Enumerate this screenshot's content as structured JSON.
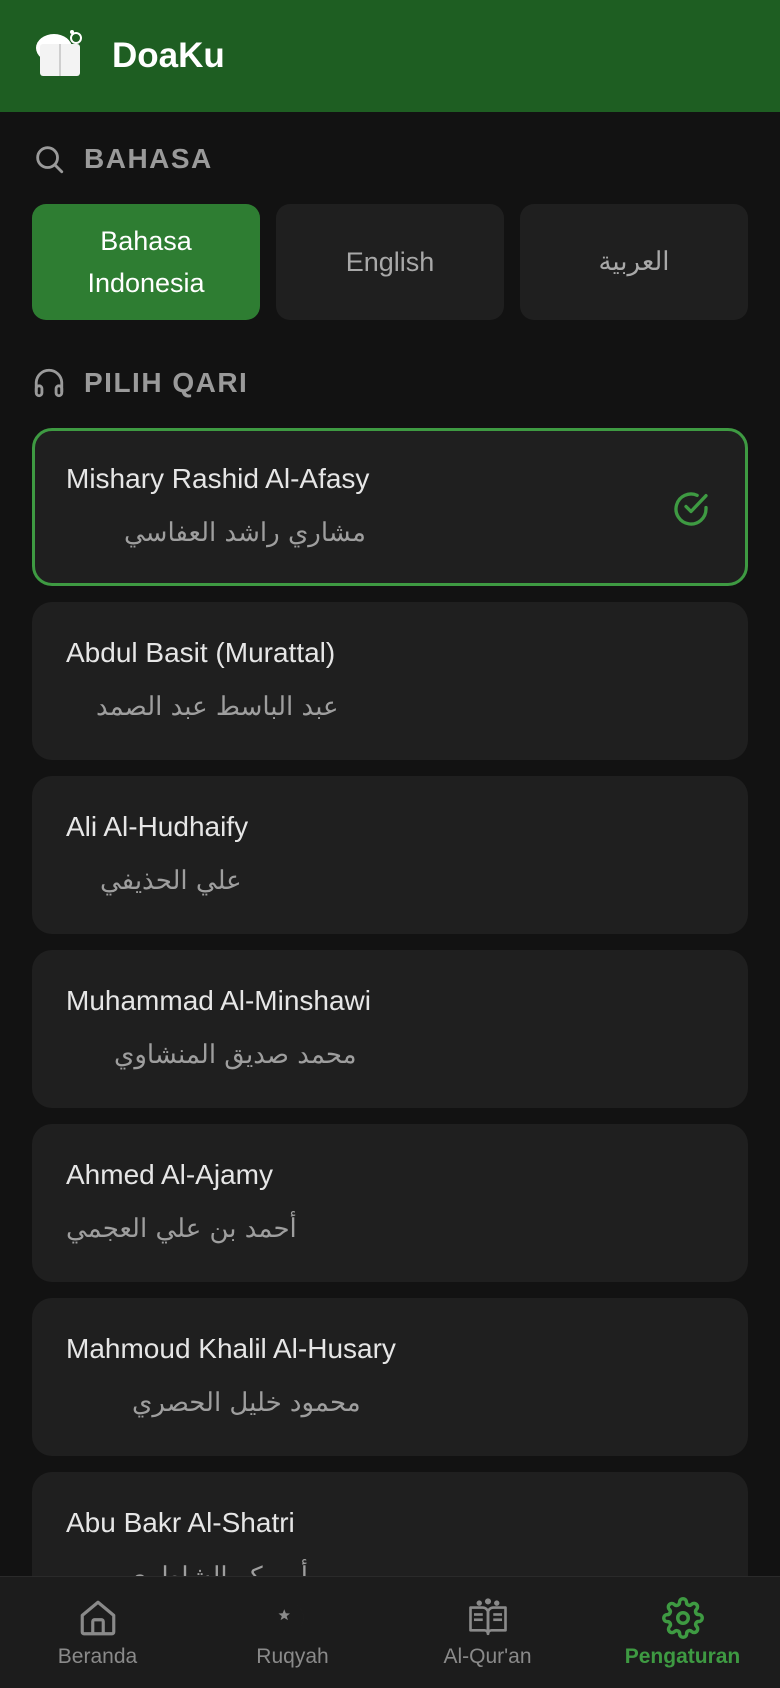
{
  "app": {
    "title": "DoaKu",
    "accent_color": "#2e7d32",
    "header_color": "#1e5e22"
  },
  "language_section": {
    "title": "BAHASA",
    "icon": "search-icon",
    "options": [
      {
        "label": "Bahasa Indonesia",
        "selected": true
      },
      {
        "label": "English",
        "selected": false
      },
      {
        "label": "العربية",
        "selected": false
      }
    ]
  },
  "qari_section": {
    "title": "PILIH QARI",
    "icon": "headphones-icon",
    "items": [
      {
        "name": "Mishary Rashid Al-Afasy",
        "arabic": "مشاري راشد العفاسي",
        "selected": true
      },
      {
        "name": "Abdul Basit (Murattal)",
        "arabic": "عبد الباسط عبد الصمد",
        "selected": false
      },
      {
        "name": "Ali Al-Hudhaify",
        "arabic": "علي الحذيفي",
        "selected": false
      },
      {
        "name": "Muhammad Al-Minshawi",
        "arabic": "محمد صديق المنشاوي",
        "selected": false
      },
      {
        "name": "Ahmed Al-Ajamy",
        "arabic": "أحمد بن علي العجمي",
        "selected": false
      },
      {
        "name": "Mahmoud Khalil Al-Husary",
        "arabic": "محمود خليل الحصري",
        "selected": false
      },
      {
        "name": "Abu Bakr Al-Shatri",
        "arabic": "أبو بكر الشاطري",
        "selected": false
      }
    ]
  },
  "bottom_nav": {
    "items": [
      {
        "label": "Beranda",
        "icon": "home-icon",
        "active": false
      },
      {
        "label": "Ruqyah",
        "icon": "moon-star-icon",
        "active": false
      },
      {
        "label": "Al-Qur'an",
        "icon": "open-book-icon",
        "active": false
      },
      {
        "label": "Pengaturan",
        "icon": "gear-icon",
        "active": true
      }
    ]
  }
}
